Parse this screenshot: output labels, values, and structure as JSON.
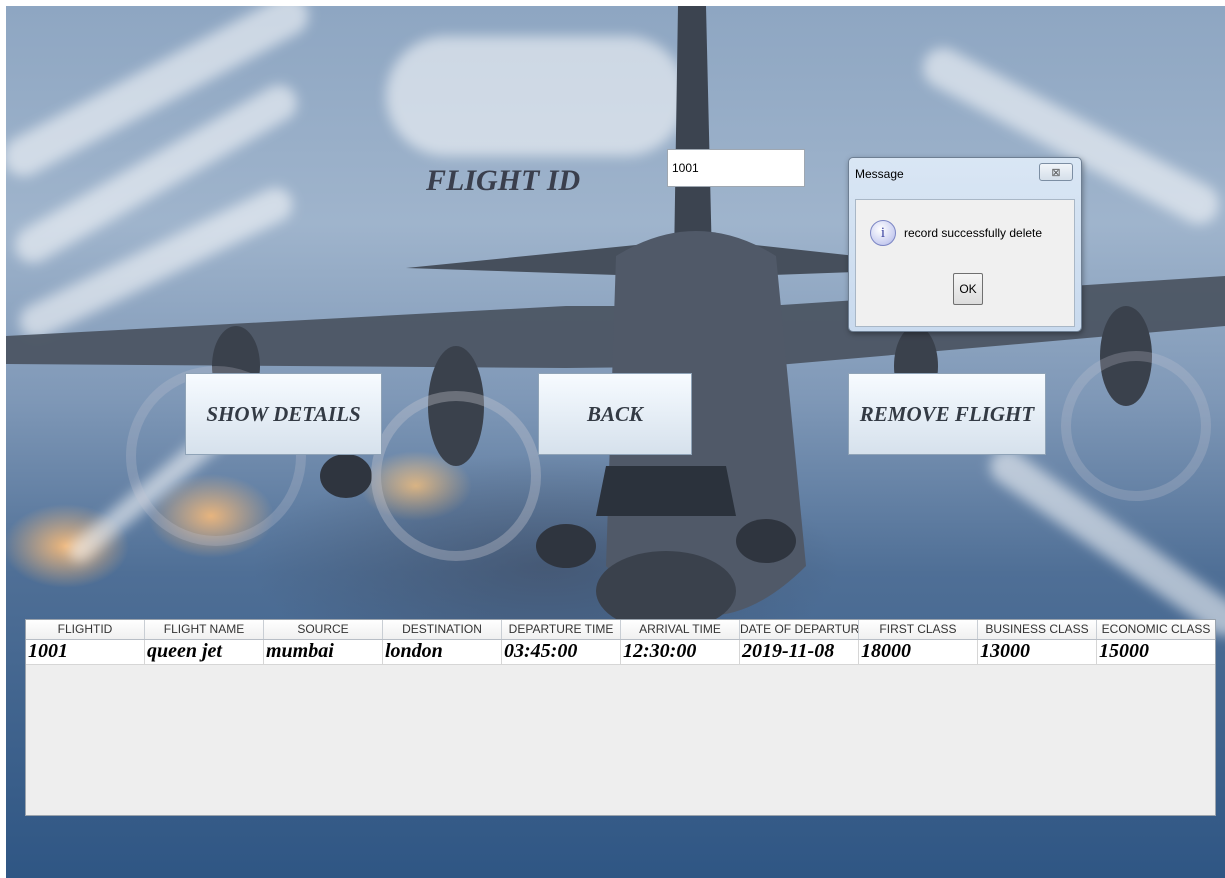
{
  "form": {
    "flight_id_label": "FLIGHT ID",
    "flight_id_value": "1001"
  },
  "buttons": {
    "show_details": "SHOW DETAILS",
    "back": "BACK",
    "remove_flight": "REMOVE FLIGHT"
  },
  "dialog": {
    "title": "Message",
    "close_glyph": "⊠",
    "icon": "info-icon",
    "icon_glyph": "i",
    "message": "record successfully delete",
    "ok_label": "OK"
  },
  "table": {
    "columns": [
      "FLIGHTID",
      "FLIGHT NAME",
      "SOURCE",
      "DESTINATION",
      "DEPARTURE TIME",
      "ARRIVAL TIME",
      "DATE OF DEPARTURE",
      "FIRST CLASS",
      "BUSINESS CLASS",
      "ECONOMIC CLASS"
    ],
    "rows": [
      [
        "1001",
        "queen jet",
        "mumbai",
        "london",
        "03:45:00",
        "12:30:00",
        "2019-11-08",
        "18000",
        "13000",
        "15000"
      ]
    ]
  }
}
